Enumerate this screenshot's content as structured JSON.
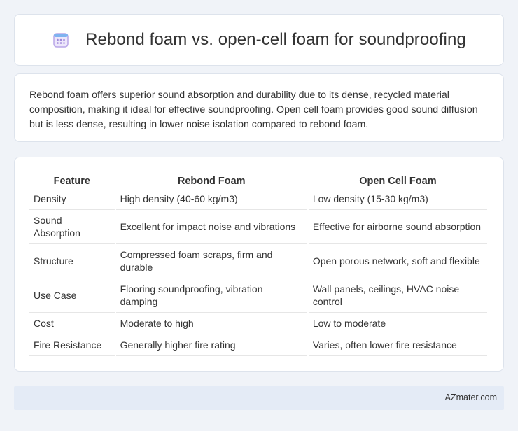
{
  "header": {
    "title": "Rebond foam vs. open-cell foam for soundproofing",
    "icon": "calendar-grid-icon"
  },
  "summary": {
    "text": "Rebond foam offers superior sound absorption and durability due to its dense, recycled material composition, making it ideal for effective soundproofing. Open cell foam provides good sound diffusion but is less dense, resulting in lower noise isolation compared to rebond foam."
  },
  "table": {
    "headers": [
      "Feature",
      "Rebond Foam",
      "Open Cell Foam"
    ],
    "rows": [
      [
        "Density",
        "High density (40-60 kg/m3)",
        "Low density (15-30 kg/m3)"
      ],
      [
        "Sound Absorption",
        "Excellent for impact noise and vibrations",
        "Effective for airborne sound absorption"
      ],
      [
        "Structure",
        "Compressed foam scraps, firm and durable",
        "Open porous network, soft and flexible"
      ],
      [
        "Use Case",
        "Flooring soundproofing, vibration damping",
        "Wall panels, ceilings, HVAC noise control"
      ],
      [
        "Cost",
        "Moderate to high",
        "Low to moderate"
      ],
      [
        "Fire Resistance",
        "Generally higher fire rating",
        "Varies, often lower fire resistance"
      ]
    ]
  },
  "footer": {
    "site": "AZmater.com"
  },
  "colors": {
    "background": "#f0f3f8",
    "footer_bg": "#e4ebf6",
    "icon_accent": "#8e7cc3"
  }
}
